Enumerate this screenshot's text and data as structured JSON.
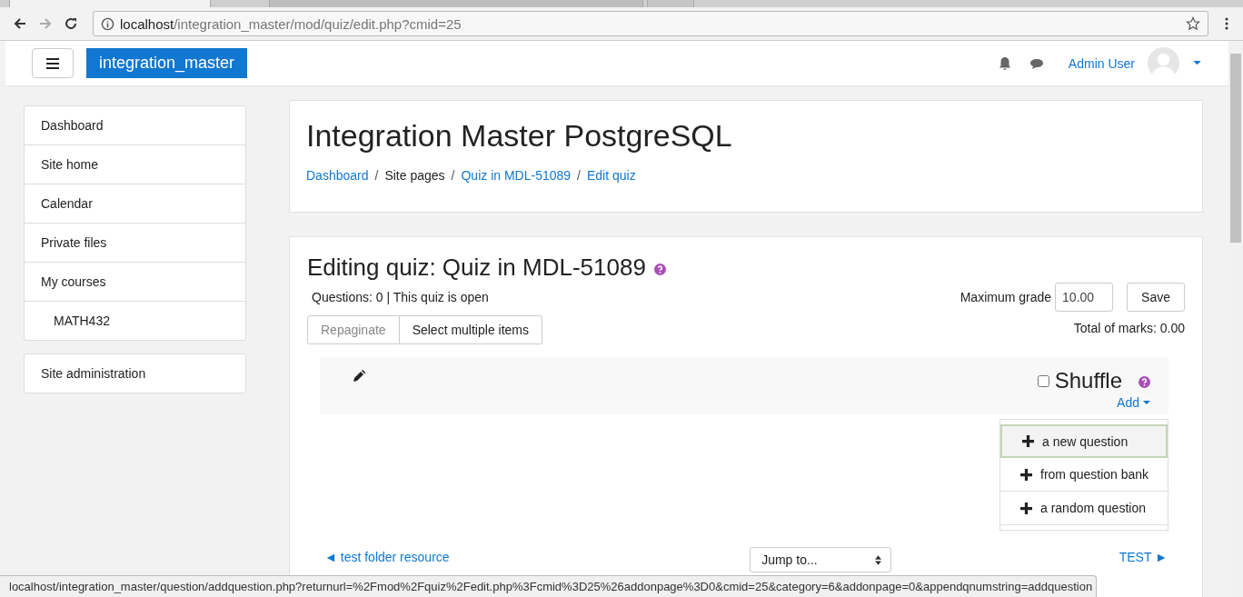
{
  "browser": {
    "url_host": "localhost",
    "url_path": "/integration_master/mod/quiz/edit.php?cmid=25",
    "status_url": "localhost/integration_master/question/addquestion.php?returnurl=%2Fmod%2Fquiz%2Fedit.php%3Fcmid%3D25%26addonpage%3D0&cmid=25&category=6&addonpage=0&appendqnumstring=addquestion"
  },
  "navbar": {
    "brand": "integration_master",
    "user": "Admin User"
  },
  "sidebar": {
    "items": [
      {
        "label": "Dashboard"
      },
      {
        "label": "Site home"
      },
      {
        "label": "Calendar"
      },
      {
        "label": "Private files"
      },
      {
        "label": "My courses",
        "children": [
          {
            "label": "MATH432"
          }
        ]
      }
    ],
    "admin": "Site administration"
  },
  "header": {
    "title": "Integration Master PostgreSQL",
    "breadcrumb": [
      {
        "label": "Dashboard",
        "kind": "link"
      },
      {
        "label": "/",
        "kind": "separator"
      },
      {
        "label": "Site pages",
        "kind": "text"
      },
      {
        "label": "/",
        "kind": "separator"
      },
      {
        "label": "Quiz in MDL-51089",
        "kind": "link"
      },
      {
        "label": "/",
        "kind": "separator"
      },
      {
        "label": "Edit quiz",
        "kind": "link"
      }
    ]
  },
  "quiz": {
    "title": "Editing quiz: Quiz in MDL-51089",
    "status": "Questions: 0 | This quiz is open",
    "buttons": [
      {
        "label": "Repaginate",
        "disabled": true
      },
      {
        "label": "Select multiple items",
        "disabled": false
      }
    ],
    "max_grade_label": "Maximum grade",
    "max_grade": "10.00",
    "save": "Save",
    "total": "Total of marks: 0.00",
    "shuffle": {
      "label": "Shuffle",
      "checked": false
    },
    "add": "Add",
    "add_menu": [
      {
        "label": "a new question",
        "selected": true
      },
      {
        "label": "from question bank",
        "selected": false
      },
      {
        "label": "a random question",
        "selected": false
      }
    ],
    "prev": "◄ test folder resource",
    "jump": "Jump to...",
    "next": "TEST ►"
  }
}
